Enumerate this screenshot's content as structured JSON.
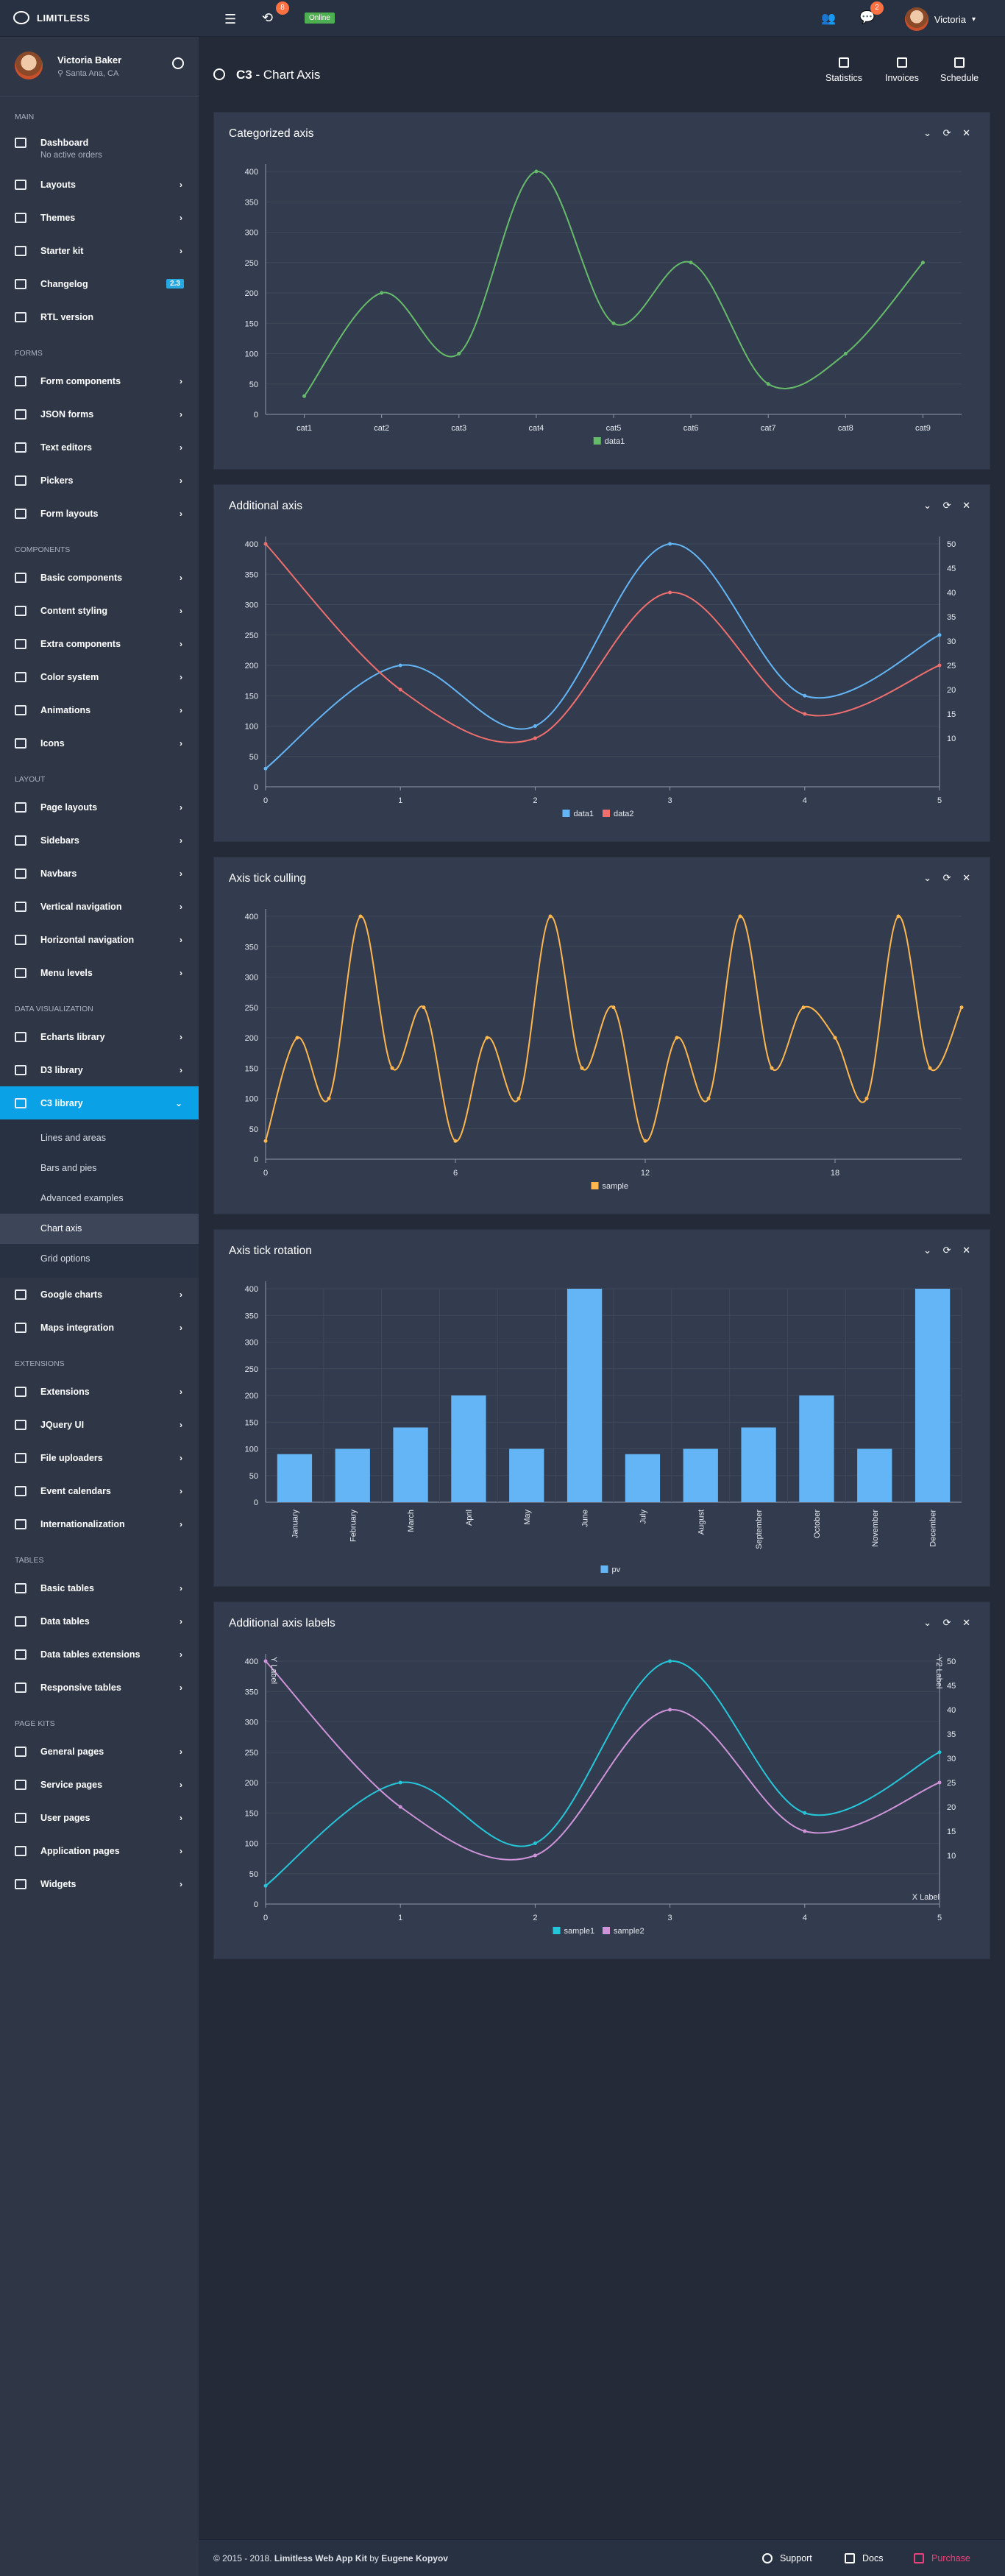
{
  "app": {
    "brand": "LIMITLESS",
    "status": "Online",
    "notif_count": "8",
    "msg_count": "2",
    "user_name": "Victoria"
  },
  "sidebar": {
    "user": {
      "name": "Victoria Baker",
      "location": "Santa Ana, CA"
    },
    "sections": [
      {
        "title": "Main",
        "items": [
          {
            "label": "Dashboard",
            "sub": "No active orders",
            "icon": "home-icon"
          },
          {
            "label": "Layouts",
            "icon": "copy-icon",
            "chevron": true
          },
          {
            "label": "Themes",
            "icon": "paint-icon",
            "chevron": true
          },
          {
            "label": "Starter kit",
            "icon": "stack-icon",
            "chevron": true
          },
          {
            "label": "Changelog",
            "icon": "list-icon",
            "badge": "2.3"
          },
          {
            "label": "RTL version",
            "icon": "width-icon"
          }
        ]
      },
      {
        "title": "Forms",
        "items": [
          {
            "label": "Form components",
            "icon": "pencil-icon",
            "chevron": true
          },
          {
            "label": "JSON forms",
            "icon": "file-icon",
            "chevron": true
          },
          {
            "label": "Text editors",
            "icon": "text-icon",
            "chevron": true
          },
          {
            "label": "Pickers",
            "icon": "calendar-icon",
            "chevron": true
          },
          {
            "label": "Form layouts",
            "icon": "layout-icon",
            "chevron": true
          }
        ]
      },
      {
        "title": "Components",
        "items": [
          {
            "label": "Basic components",
            "icon": "grid-icon",
            "chevron": true
          },
          {
            "label": "Content styling",
            "icon": "droplet-icon",
            "chevron": true
          },
          {
            "label": "Extra components",
            "icon": "gift-icon",
            "chevron": true
          },
          {
            "label": "Color system",
            "icon": "palette-icon",
            "chevron": true
          },
          {
            "label": "Animations",
            "icon": "spinner-icon",
            "chevron": true
          },
          {
            "label": "Icons",
            "icon": "star-icon",
            "chevron": true
          }
        ]
      },
      {
        "title": "Layout",
        "items": [
          {
            "label": "Page layouts",
            "icon": "layers-icon",
            "chevron": true
          },
          {
            "label": "Sidebars",
            "icon": "sidebar-icon",
            "chevron": true
          },
          {
            "label": "Navbars",
            "icon": "menu-icon",
            "chevron": true
          },
          {
            "label": "Vertical navigation",
            "icon": "sort-icon",
            "chevron": true
          },
          {
            "label": "Horizontal navigation",
            "icon": "transfer-icon",
            "chevron": true
          },
          {
            "label": "Menu levels",
            "icon": "tree-icon",
            "chevron": true
          }
        ]
      },
      {
        "title": "Data visualization",
        "items": [
          {
            "label": "Echarts library",
            "icon": "bar-chart-icon",
            "chevron": true
          },
          {
            "label": "D3 library",
            "icon": "line-chart-icon",
            "chevron": true
          },
          {
            "label": "C3 library",
            "icon": "area-chart-icon",
            "chevron": true,
            "active": true,
            "children": [
              "Lines and areas",
              "Bars and pies",
              "Advanced examples",
              "Chart axis",
              "Grid options"
            ],
            "current_child": 3
          },
          {
            "label": "Google charts",
            "icon": "pie-chart-icon",
            "chevron": true
          },
          {
            "label": "Maps integration",
            "icon": "map-icon",
            "chevron": true
          }
        ]
      },
      {
        "title": "Extensions",
        "items": [
          {
            "label": "Extensions",
            "icon": "puzzle-icon",
            "chevron": true
          },
          {
            "label": "JQuery UI",
            "icon": "box-icon",
            "chevron": true
          },
          {
            "label": "File uploaders",
            "icon": "upload-icon",
            "chevron": true
          },
          {
            "label": "Event calendars",
            "icon": "calendar-event-icon",
            "chevron": true
          },
          {
            "label": "Internationalization",
            "icon": "globe-icon",
            "chevron": true
          }
        ]
      },
      {
        "title": "Tables",
        "items": [
          {
            "label": "Basic tables",
            "icon": "table-icon",
            "chevron": true
          },
          {
            "label": "Data tables",
            "icon": "table-grid-icon",
            "chevron": true
          },
          {
            "label": "Data tables extensions",
            "icon": "magic-icon",
            "chevron": true
          },
          {
            "label": "Responsive tables",
            "icon": "responsive-icon",
            "chevron": true
          }
        ]
      },
      {
        "title": "Page kits",
        "items": [
          {
            "label": "General pages",
            "icon": "grid-four-icon",
            "chevron": true
          },
          {
            "label": "Service pages",
            "icon": "cogs-icon",
            "chevron": true
          },
          {
            "label": "User pages",
            "icon": "users-icon",
            "chevron": true
          },
          {
            "label": "Application pages",
            "icon": "app-icon",
            "chevron": true
          },
          {
            "label": "Widgets",
            "icon": "widgets-icon",
            "chevron": true
          }
        ]
      }
    ]
  },
  "header": {
    "title_bold": "C3",
    "title_rest": " - Chart Axis",
    "buttons": [
      "Statistics",
      "Invoices",
      "Schedule"
    ]
  },
  "cards": [
    {
      "title": "Categorized axis"
    },
    {
      "title": "Additional axis"
    },
    {
      "title": "Axis tick culling"
    },
    {
      "title": "Axis tick rotation"
    },
    {
      "title": "Additional axis labels"
    }
  ],
  "chart_data": [
    {
      "type": "line",
      "title": "Categorized axis",
      "categories": [
        "cat1",
        "cat2",
        "cat3",
        "cat4",
        "cat5",
        "cat6",
        "cat7",
        "cat8",
        "cat9"
      ],
      "series": [
        {
          "name": "data1",
          "values": [
            30,
            200,
            100,
            400,
            150,
            250,
            50,
            100,
            250
          ],
          "color": "#66bb6a"
        }
      ],
      "ylim": [
        0,
        400
      ],
      "yticks": [
        0,
        50,
        100,
        150,
        200,
        250,
        300,
        350,
        400
      ],
      "grid": true,
      "legend": "bottom"
    },
    {
      "type": "line",
      "title": "Additional axis",
      "x": [
        0,
        1,
        2,
        3,
        4,
        5
      ],
      "series": [
        {
          "name": "data1",
          "values": [
            30,
            200,
            100,
            400,
            150,
            250
          ],
          "color": "#64b5f6",
          "axis": "y"
        },
        {
          "name": "data2",
          "values": [
            50,
            20,
            10,
            40,
            15,
            25
          ],
          "color": "#ef6e6e",
          "axis": "y2"
        }
      ],
      "ylim": [
        0,
        400
      ],
      "yticks": [
        0,
        50,
        100,
        150,
        200,
        250,
        300,
        350,
        400
      ],
      "y2ticks": [
        10,
        15,
        20,
        25,
        30,
        35,
        40,
        45,
        50
      ],
      "grid": true,
      "legend": "bottom"
    },
    {
      "type": "line",
      "title": "Axis tick culling",
      "x": [
        0,
        1,
        2,
        3,
        4,
        5,
        6,
        7,
        8,
        9,
        10,
        11,
        12,
        13,
        14,
        15,
        16,
        17,
        18,
        19,
        20,
        21,
        22,
        23
      ],
      "xticks": [
        0,
        6,
        12,
        18
      ],
      "series": [
        {
          "name": "sample",
          "values": [
            30,
            200,
            100,
            400,
            150,
            250,
            30,
            200,
            100,
            400,
            150,
            250,
            30,
            200,
            100,
            400,
            150,
            250,
            200,
            100,
            400,
            150,
            250
          ],
          "color": "#ffb74d"
        }
      ],
      "ylim": [
        0,
        400
      ],
      "yticks": [
        0,
        50,
        100,
        150,
        200,
        250,
        300,
        350,
        400
      ],
      "grid": true,
      "legend": "bottom"
    },
    {
      "type": "bar",
      "title": "Axis tick rotation",
      "categories": [
        "January",
        "February",
        "March",
        "April",
        "May",
        "June",
        "July",
        "August",
        "September",
        "October",
        "November",
        "December"
      ],
      "series": [
        {
          "name": "pv",
          "values": [
            90,
            100,
            140,
            200,
            100,
            400,
            90,
            100,
            140,
            200,
            100,
            400
          ],
          "color": "#64b5f6"
        }
      ],
      "ylim": [
        0,
        400
      ],
      "yticks": [
        0,
        50,
        100,
        150,
        200,
        250,
        300,
        350,
        400
      ],
      "grid": true,
      "legend": "bottom"
    },
    {
      "type": "line",
      "title": "Additional axis labels",
      "x": [
        0,
        1,
        2,
        3,
        4,
        5
      ],
      "series": [
        {
          "name": "sample1",
          "values": [
            30,
            200,
            100,
            400,
            150,
            250
          ],
          "color": "#26c6da",
          "axis": "y"
        },
        {
          "name": "sample2",
          "values": [
            50,
            20,
            10,
            40,
            15,
            25
          ],
          "color": "#ce93d8",
          "axis": "y2"
        }
      ],
      "ylim": [
        0,
        400
      ],
      "yticks": [
        0,
        50,
        100,
        150,
        200,
        250,
        300,
        350,
        400
      ],
      "y2ticks": [
        10,
        15,
        20,
        25,
        30,
        35,
        40,
        45,
        50
      ],
      "ylabel": "Y Label",
      "y2label": "Y2 Label",
      "xlabel": "X Label",
      "grid": true,
      "legend": "bottom"
    }
  ],
  "footer": {
    "copyright": "© 2015 - 2018. ",
    "copyright_link": "Limitless Web App Kit",
    "copyright_by": " by ",
    "author": "Eugene Kopyov",
    "links": [
      "Support",
      "Docs",
      "Purchase"
    ]
  }
}
